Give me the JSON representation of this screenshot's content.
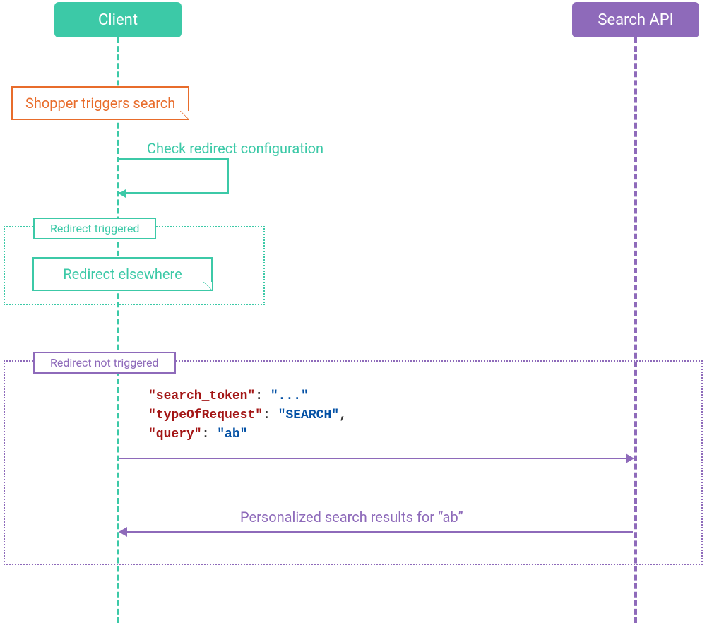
{
  "participants": {
    "client": "Client",
    "api": "Search API"
  },
  "trigger_note": "Shopper triggers search",
  "self_message": "Check redirect configuration",
  "fragments": {
    "redirect_triggered": {
      "label": "Redirect triggered",
      "note": "Redirect elsewhere"
    },
    "redirect_not_triggered": {
      "label": "Redirect not triggered"
    }
  },
  "request_payload": {
    "line1_key": "\"search_token\"",
    "line1_val": "\"...\"",
    "line2_key": "\"typeOfRequest\"",
    "line2_val": "\"SEARCH\"",
    "line3_key": "\"query\"",
    "line3_val": "\"ab\""
  },
  "response_label": "Personalized search results for “ab”",
  "colors": {
    "teal": "#3cc9a7",
    "purple": "#8e6aba",
    "orange": "#e86c2b"
  },
  "chart_data": {
    "type": "sequence_diagram",
    "participants": [
      "Client",
      "Search API"
    ],
    "steps": [
      {
        "from": "Client",
        "to": "Client",
        "kind": "note",
        "text": "Shopper triggers search"
      },
      {
        "from": "Client",
        "to": "Client",
        "kind": "self_message",
        "text": "Check redirect configuration"
      },
      {
        "kind": "alt",
        "guard": "Redirect triggered",
        "steps": [
          {
            "from": "Client",
            "to": "Client",
            "kind": "note",
            "text": "Redirect elsewhere"
          }
        ]
      },
      {
        "kind": "alt",
        "guard": "Redirect not triggered",
        "steps": [
          {
            "from": "Client",
            "to": "Search API",
            "kind": "request",
            "payload": {
              "search_token": "...",
              "typeOfRequest": "SEARCH",
              "query": "ab"
            }
          },
          {
            "from": "Search API",
            "to": "Client",
            "kind": "response",
            "text": "Personalized search results for \"ab\""
          }
        ]
      }
    ]
  }
}
